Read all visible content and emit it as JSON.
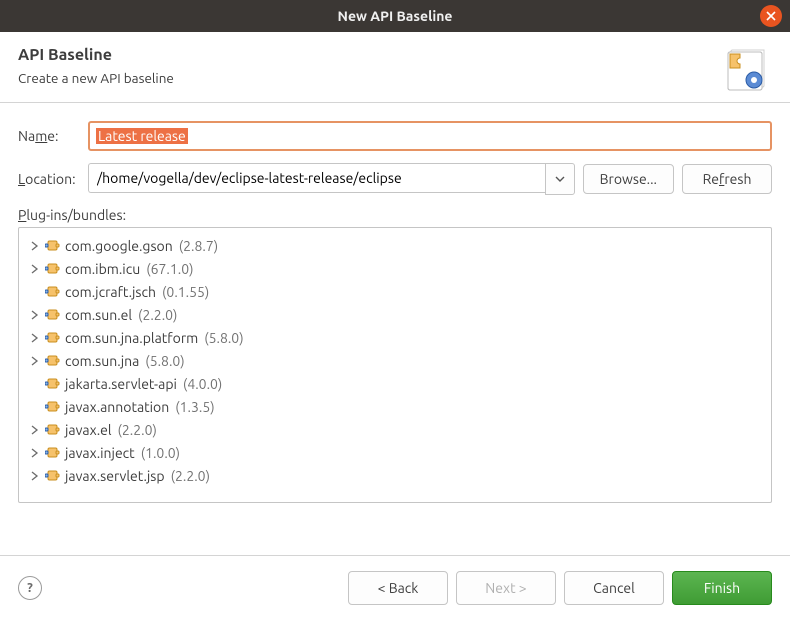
{
  "window": {
    "title": "New API Baseline"
  },
  "header": {
    "title": "API Baseline",
    "subtitle": "Create a new API baseline"
  },
  "form": {
    "name_label_pre": "Na",
    "name_label_u": "m",
    "name_label_post": "e:",
    "name_value": "Latest release",
    "location_label_u": "L",
    "location_label_post": "ocation:",
    "location_value": "/home/vogella/dev/eclipse-latest-release/eclipse",
    "browse_label": "Browse...",
    "refresh_pre": "Re",
    "refresh_u": "f",
    "refresh_post": "resh",
    "plugins_label_u": "P",
    "plugins_label_post": "lug-ins/bundles:"
  },
  "tree": [
    {
      "expandable": true,
      "name": "com.google.gson",
      "version": "(2.8.7)"
    },
    {
      "expandable": true,
      "name": "com.ibm.icu",
      "version": "(67.1.0)"
    },
    {
      "expandable": false,
      "name": "com.jcraft.jsch",
      "version": "(0.1.55)"
    },
    {
      "expandable": true,
      "name": "com.sun.el",
      "version": "(2.2.0)"
    },
    {
      "expandable": true,
      "name": "com.sun.jna.platform",
      "version": "(5.8.0)"
    },
    {
      "expandable": true,
      "name": "com.sun.jna",
      "version": "(5.8.0)"
    },
    {
      "expandable": false,
      "name": "jakarta.servlet-api",
      "version": "(4.0.0)"
    },
    {
      "expandable": false,
      "name": "javax.annotation",
      "version": "(1.3.5)"
    },
    {
      "expandable": true,
      "name": "javax.el",
      "version": "(2.2.0)"
    },
    {
      "expandable": true,
      "name": "javax.inject",
      "version": "(1.0.0)"
    },
    {
      "expandable": true,
      "name": "javax.servlet.jsp",
      "version": "(2.2.0)"
    }
  ],
  "footer": {
    "back": "< Back",
    "next": "Next >",
    "cancel": "Cancel",
    "finish": "Finish"
  }
}
